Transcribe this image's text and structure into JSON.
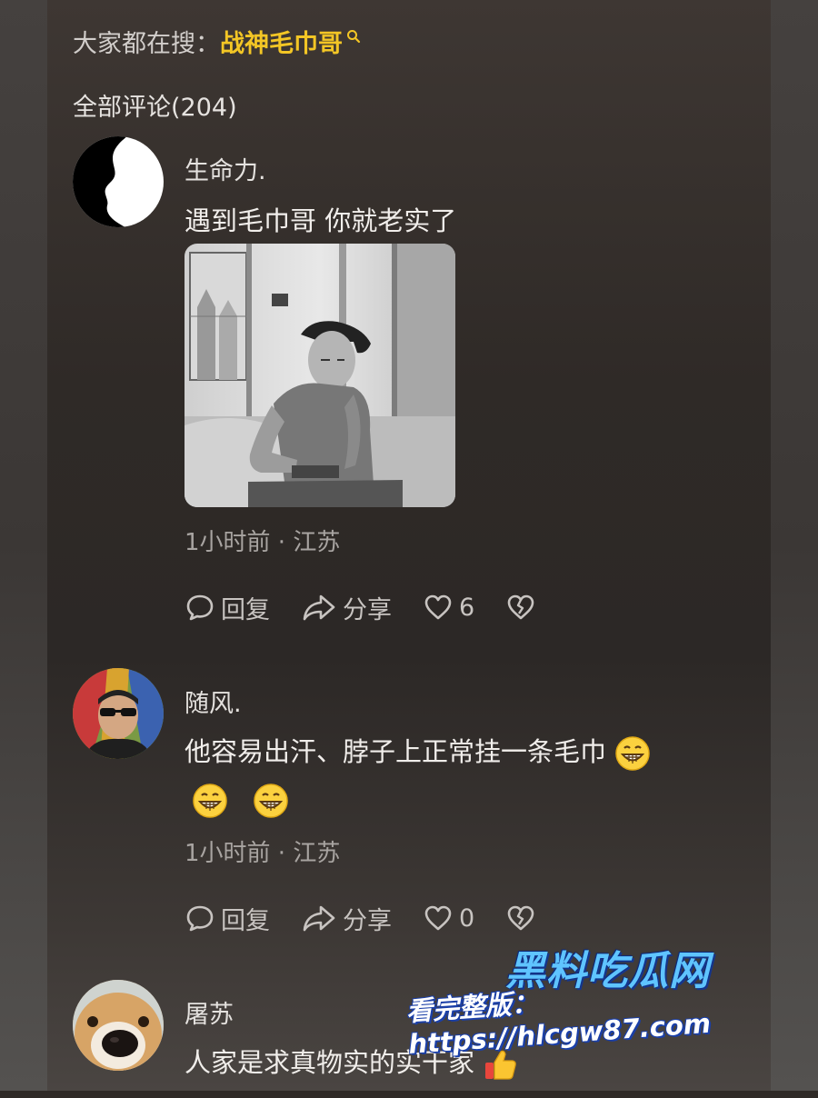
{
  "trending": {
    "prefix": "大家都在搜：",
    "keyword": "战神毛巾哥"
  },
  "comments_header": "全部评论(204)",
  "comments": [
    {
      "username": "生命力.",
      "text": "遇到毛巾哥 你就老实了",
      "meta": "1小时前 · 江苏",
      "reply_label": "回复",
      "share_label": "分享",
      "like_count": "6"
    },
    {
      "username": "随风.",
      "text_line1": "他容易出汗、脖子上正常挂一条毛巾",
      "meta": "1小时前 · 江苏",
      "reply_label": "回复",
      "share_label": "分享",
      "like_count": "0"
    },
    {
      "username": "屠苏",
      "text": "人家是求真物实的实干家"
    }
  ],
  "watermark": {
    "logo": "黑料吃瓜网",
    "url": "看完整版：https://hlcgw87.com"
  },
  "colors": {
    "keyword": "#f3c625",
    "watermark_blue": "#5fc4ff"
  }
}
